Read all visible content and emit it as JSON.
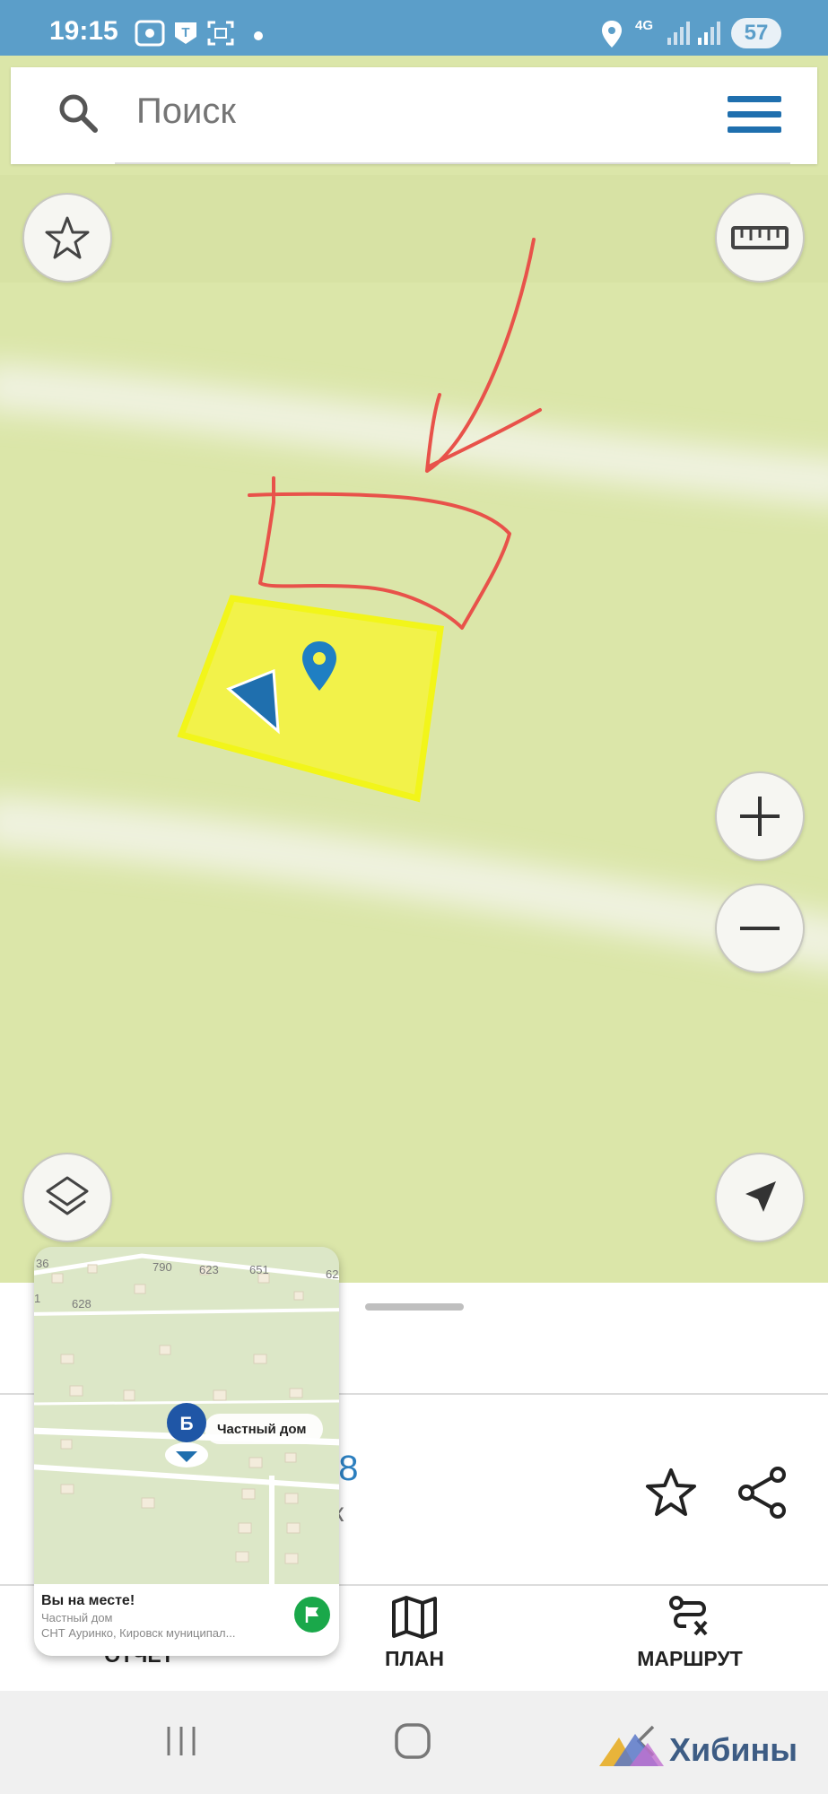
{
  "status_bar": {
    "time": "19:15",
    "network": "4G",
    "battery": "57",
    "icons": [
      "image-icon",
      "t-icon",
      "screenshot-icon",
      "dot-icon",
      "location-icon",
      "signal-icon",
      "signal-icon"
    ]
  },
  "search": {
    "placeholder": "Поиск",
    "menu_icon": "hamburger-menu-icon"
  },
  "map": {
    "buttons": [
      "favorite-star-icon",
      "ruler-icon",
      "zoom-in-icon",
      "zoom-out-icon",
      "layers-icon",
      "my-location-arrow-icon"
    ],
    "highlight_color": "#f2f24a",
    "annotation_color": "#e8524a",
    "marker_color": "#1f7fc3"
  },
  "place": {
    "id_fragment": "78",
    "sub_fragment": "к",
    "actions": [
      "star-icon",
      "share-icon"
    ]
  },
  "tabs": [
    {
      "label": "ОТЧЁТ",
      "icon": "report-icon"
    },
    {
      "label": "ПЛАН",
      "icon": "map-plan-icon"
    },
    {
      "label": "МАРШРУТ",
      "icon": "route-icon"
    }
  ],
  "popup": {
    "map_labels": [
      "36",
      "790",
      "623",
      "651",
      "62",
      "628",
      "1"
    ],
    "marker_letter": "Б",
    "marker_label": "Частный дом",
    "title": "Вы на месте!",
    "type": "Частный дом",
    "address": "СНТ Ауринко, Кировск муниципал..."
  },
  "watermark": {
    "text": "Хибины"
  },
  "nav": [
    "recents-icon",
    "home-icon",
    "back-icon"
  ]
}
